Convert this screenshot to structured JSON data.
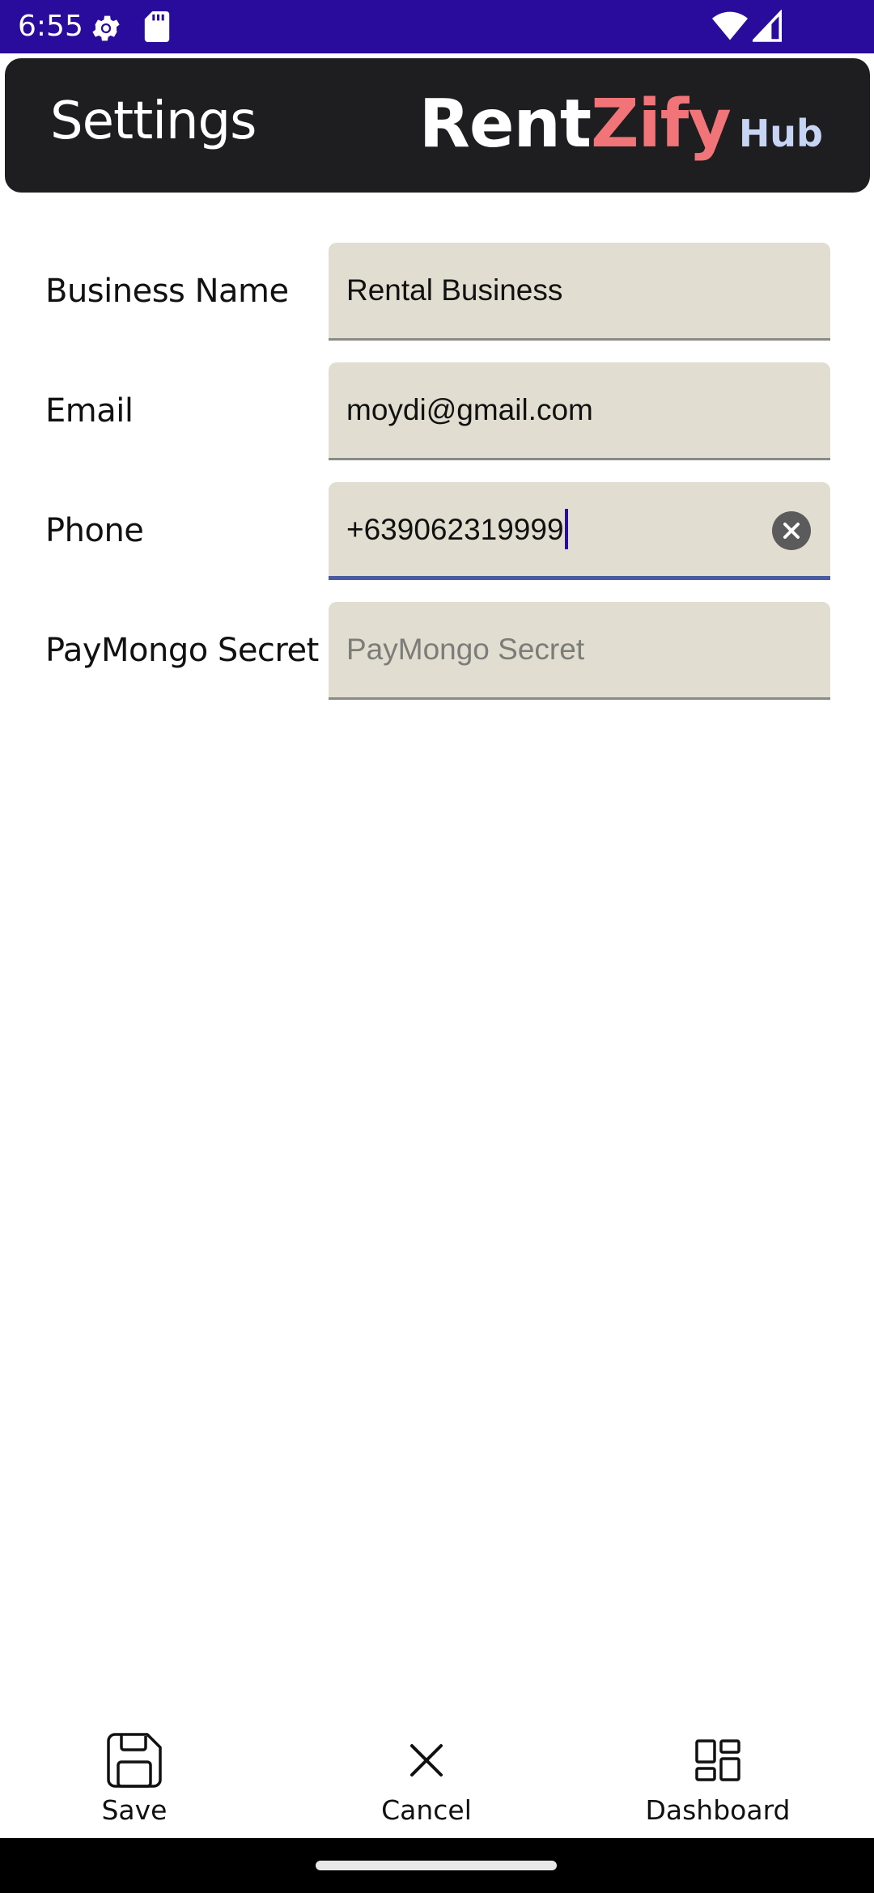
{
  "status_bar": {
    "time": "6:55",
    "background": "#2a0c9c",
    "icons": [
      "gear-icon",
      "sd-card-icon",
      "wifi-icon",
      "signal-icon"
    ]
  },
  "header": {
    "title": "Settings",
    "logo": {
      "part1": "Rent",
      "part2": "Zify",
      "part3": "Hub",
      "colors": {
        "part1": "#ffffff",
        "part2": "#f07478",
        "part3": "#c7d4f4"
      }
    },
    "background": "#1e1e20"
  },
  "form": {
    "business_name": {
      "label": "Business Name",
      "value": "Rental Business"
    },
    "email": {
      "label": "Email",
      "value": "moydi@gmail.com"
    },
    "phone": {
      "label": "Phone",
      "value": "+639062319999"
    },
    "paymongo_secret": {
      "label": "PayMongo Secret",
      "value": "",
      "placeholder": "PayMongo Secret"
    }
  },
  "toolbar": {
    "save_label": "Save",
    "cancel_label": "Cancel",
    "dashboard_label": "Dashboard"
  },
  "colors": {
    "field_background": "#e1ddd0",
    "focus_underline": "#4a5aa0",
    "caret": "#2a0c9c"
  }
}
